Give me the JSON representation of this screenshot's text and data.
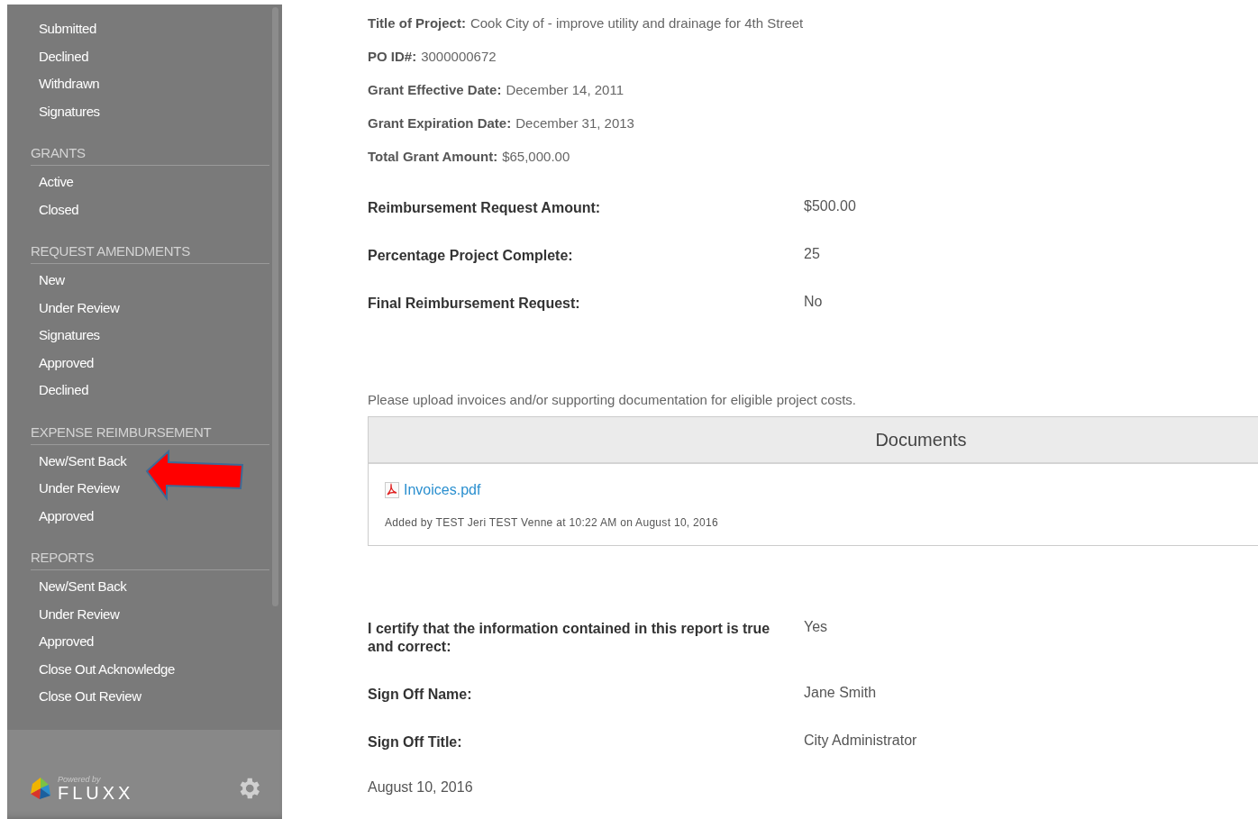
{
  "sidebar": {
    "sections": [
      {
        "items": [
          {
            "label": "Submitted"
          },
          {
            "label": "Declined"
          },
          {
            "label": "Withdrawn"
          },
          {
            "label": "Signatures"
          }
        ]
      },
      {
        "heading": "GRANTS",
        "items": [
          {
            "label": "Active"
          },
          {
            "label": "Closed"
          }
        ]
      },
      {
        "heading": "REQUEST AMENDMENTS",
        "items": [
          {
            "label": "New"
          },
          {
            "label": "Under Review"
          },
          {
            "label": "Signatures"
          },
          {
            "label": "Approved"
          },
          {
            "label": "Declined"
          }
        ]
      },
      {
        "heading": "EXPENSE REIMBURSEMENT",
        "items": [
          {
            "label": "New/Sent Back"
          },
          {
            "label": "Under Review"
          },
          {
            "label": "Approved"
          }
        ]
      },
      {
        "heading": "REPORTS",
        "items": [
          {
            "label": "New/Sent Back"
          },
          {
            "label": "Under Review"
          },
          {
            "label": "Approved"
          },
          {
            "label": "Close Out Acknowledge"
          },
          {
            "label": "Close Out Review"
          }
        ]
      }
    ],
    "footer": {
      "powered_by": "Powered by",
      "brand": "FLUXX"
    }
  },
  "summary": [
    {
      "label": "Title of Project:",
      "value": "Cook City of - improve utility and drainage for 4th Street"
    },
    {
      "label": "PO ID#:",
      "value": "3000000672"
    },
    {
      "label": "Grant Effective Date:",
      "value": "December 14, 2011"
    },
    {
      "label": "Grant Expiration Date:",
      "value": "December 31, 2013"
    },
    {
      "label": "Total Grant Amount:",
      "value": "$65,000.00"
    }
  ],
  "fields": [
    {
      "label": "Reimbursement Request Amount:",
      "value": "$500.00"
    },
    {
      "label": "Percentage Project Complete:",
      "value": "25"
    },
    {
      "label": "Final Reimbursement Request:",
      "value": "No"
    }
  ],
  "upload_note": "Please upload invoices and/or supporting documentation for eligible project costs.",
  "documents": {
    "title": "Documents",
    "files": [
      {
        "name": "Invoices.pdf",
        "added": "Added by TEST Jeri TEST Venne at 10:22 AM on August 10, 2016"
      }
    ]
  },
  "signoff": [
    {
      "label": "I certify that the information contained in this report is true and correct:",
      "value": "Yes"
    },
    {
      "label": "Sign Off Name:",
      "value": "Jane Smith"
    },
    {
      "label": "Sign Off Title:",
      "value": "City Administrator"
    }
  ],
  "date": "August 10, 2016"
}
